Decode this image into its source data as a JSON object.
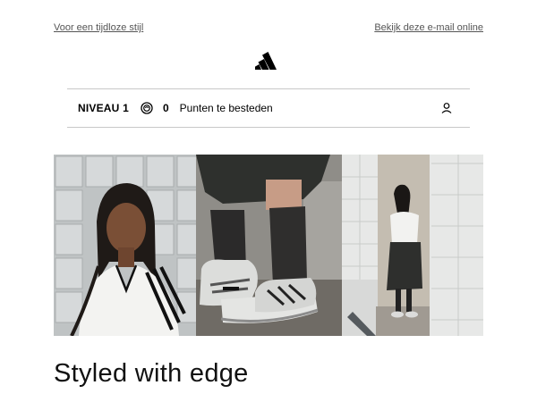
{
  "header": {
    "left_link": "Voor een tijdloze stijl",
    "right_link": "Bekijk deze e-mail online",
    "logo_icon": "adidas-logo"
  },
  "loyalty_bar": {
    "level": "NIVEAU 1",
    "points_icon": "coin-icon",
    "points_value": "0",
    "points_label": "Punten te besteden",
    "account_icon": "person-icon"
  },
  "hero": {
    "images": [
      {
        "name": "woman-in-white-jersey-photo"
      },
      {
        "name": "silver-sneakers-and-socks-photo"
      },
      {
        "name": "woman-in-tiled-hallway-photo"
      }
    ]
  },
  "headline": "Styled with edge",
  "colors": {
    "divider": "#c8c8c8",
    "link": "#555555",
    "text": "#111111"
  }
}
